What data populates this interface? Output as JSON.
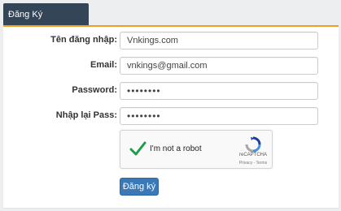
{
  "tab": {
    "label": "Đăng Ký"
  },
  "form": {
    "username": {
      "label": "Tên đăng nhập:",
      "value": "Vnkings.com"
    },
    "email": {
      "label": "Email:",
      "value": "vnkings@gmail.com"
    },
    "password": {
      "label": "Password:",
      "value": "••••••••"
    },
    "confirm_password": {
      "label": "Nhập lại Pass:",
      "value": "••••••••"
    }
  },
  "captcha": {
    "label": "I'm not a robot",
    "brand": "reCAPTCHA",
    "links": "Privacy - Terms",
    "checked": true,
    "check_color": "#1e9e4a"
  },
  "submit": {
    "label": "Đăng ký"
  },
  "colors": {
    "tab_bg": "#344558",
    "accent": "#f39c24",
    "button_bg": "#3a78b8"
  }
}
